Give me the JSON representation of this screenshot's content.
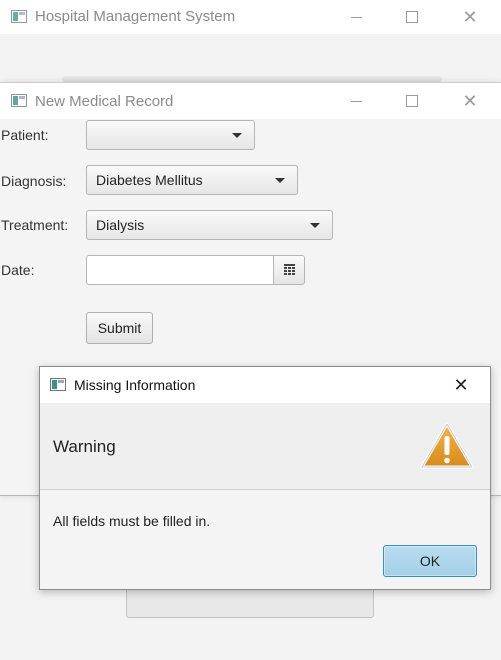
{
  "main_window": {
    "title": "Hospital Management System",
    "controls": {
      "minimize": "—",
      "maximize": "☐",
      "close": "✕"
    }
  },
  "record_window": {
    "title": "New Medical Record",
    "controls": {
      "minimize": "—",
      "maximize": "☐",
      "close": "✕"
    },
    "form": {
      "patient_label": "Patient:",
      "patient_value": "",
      "diagnosis_label": "Diagnosis:",
      "diagnosis_value": "Diabetes Mellitus",
      "treatment_label": "Treatment:",
      "treatment_value": "Dialysis",
      "date_label": "Date:",
      "date_value": "",
      "submit_label": "Submit"
    }
  },
  "alert": {
    "title": "Missing Information",
    "close": "✕",
    "header_text": "Warning",
    "content_text": "All fields must be filled in.",
    "ok_label": "OK",
    "icon": "warning-icon",
    "colors": {
      "warning": "#e3982a",
      "default_button": "#a9d3ea"
    }
  }
}
